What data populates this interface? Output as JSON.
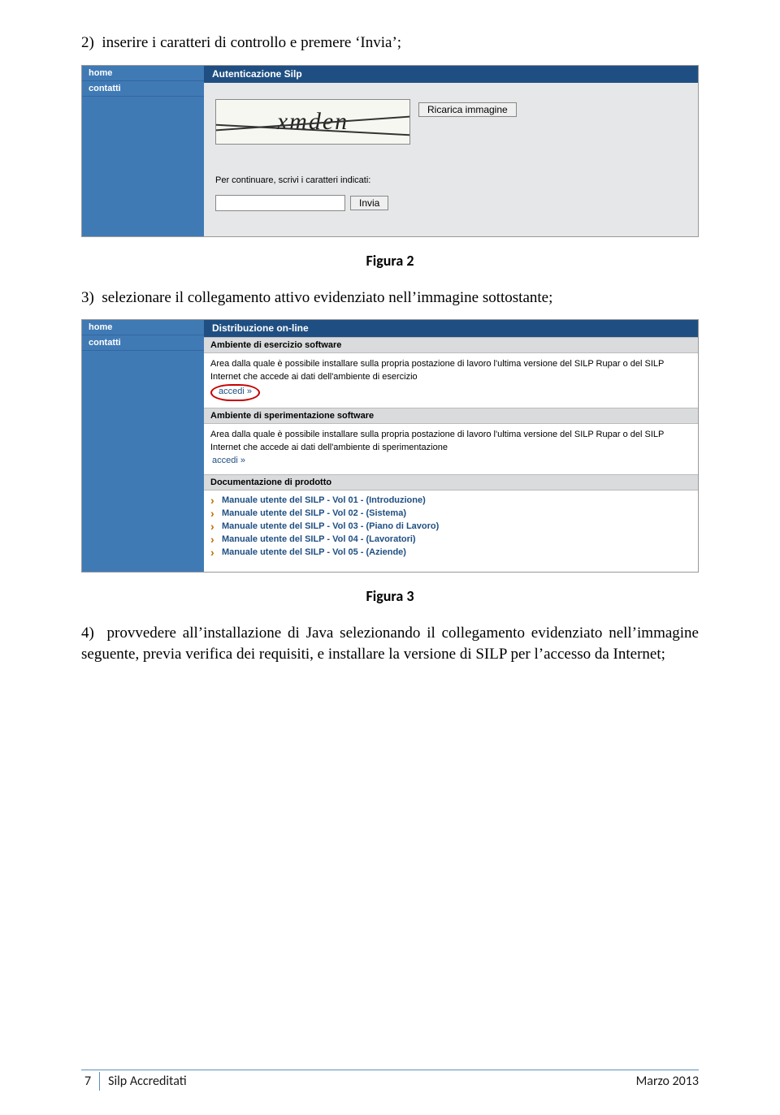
{
  "step2_text": "2)  inserire i caratteri di controllo e premere ‘Invia’;",
  "figure2_caption": "Figura 2",
  "step3_text": "3)  selezionare il collegamento attivo evidenziato nell’immagine sottostante;",
  "figure3_caption": "Figura 3",
  "step4_text": "4)  provvedere all’installazione di Java selezionando il collegamento evidenziato nell’immagine seguente, previa verifica dei requisiti, e installare la versione di SILP per l’accesso da Internet;",
  "shot1": {
    "side_home": "home",
    "side_contatti": "contatti",
    "header": "Autenticazione Silp",
    "captcha_text": "xmden",
    "reload_btn": "Ricarica immagine",
    "prompt": "Per continuare, scrivi i caratteri indicati:",
    "submit_btn": "Invia"
  },
  "shot2": {
    "side_home": "home",
    "side_contatti": "contatti",
    "header": "Distribuzione on-line",
    "sec1_title": "Ambiente di esercizio software",
    "sec1_body": "Area dalla quale è possibile installare sulla propria postazione di lavoro l'ultima versione del SILP Rupar o del SILP Internet che accede ai dati dell'ambiente di esercizio",
    "accedi1": "accedi »",
    "sec2_title": "Ambiente di sperimentazione software",
    "sec2_body": "Area dalla quale è possibile installare sulla propria postazione di lavoro l'ultima versione del SILP Rupar o del SILP Internet che accede ai dati dell'ambiente di sperimentazione",
    "accedi2": "accedi »",
    "sec3_title": "Documentazione di prodotto",
    "docs": [
      "Manuale utente del SILP - Vol 01 - (Introduzione)",
      "Manuale utente del SILP - Vol 02 - (Sistema)",
      "Manuale utente del SILP - Vol 03 - (Piano di Lavoro)",
      "Manuale utente del SILP - Vol 04 - (Lavoratori)",
      "Manuale utente del SILP - Vol 05 - (Aziende)"
    ]
  },
  "footer": {
    "page": "7",
    "title": "Silp Accreditati",
    "date": "Marzo 2013"
  }
}
